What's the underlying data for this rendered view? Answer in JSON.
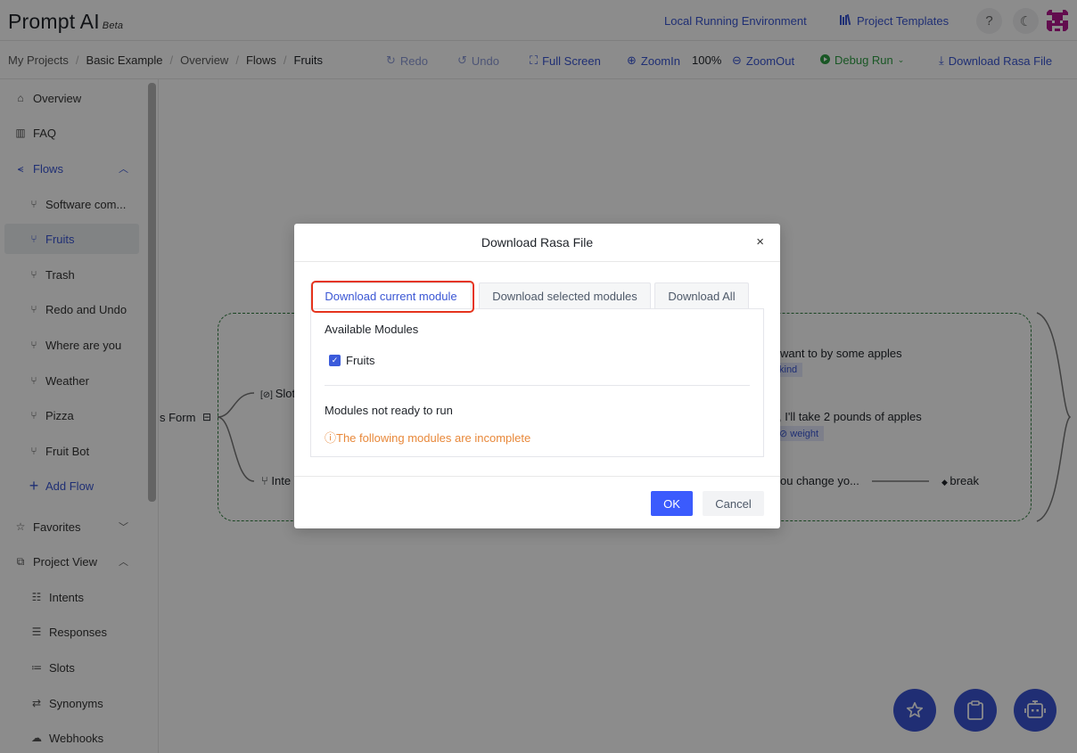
{
  "app": {
    "title": "Prompt AI",
    "badge": "Beta"
  },
  "header": {
    "local_env": "Local Running Environment",
    "templates": "Project Templates",
    "help": "?",
    "theme": "☾"
  },
  "breadcrumb": [
    "My Projects",
    "Basic Example",
    "Overview",
    "Flows",
    "Fruits"
  ],
  "toolbar": {
    "redo": "Redo",
    "undo": "Undo",
    "fullscreen": "Full Screen",
    "zoom_in": "ZoomIn",
    "zoom_level": "100%",
    "zoom_out": "ZoomOut",
    "debug_run": "Debug Run",
    "download": "Download Rasa File"
  },
  "sidebar": {
    "overview": "Overview",
    "faq": "FAQ",
    "flows": "Flows",
    "flow_items": [
      "Software com...",
      "Fruits",
      "Trash",
      "Redo and Undo",
      "Where are you",
      "Weather",
      "Pizza",
      "Fruit Bot"
    ],
    "add_flow": "Add Flow",
    "favorites": "Favorites",
    "project_view": "Project View",
    "project_items": [
      "Intents",
      "Responses",
      "Slots",
      "Synonyms",
      "Webhooks"
    ]
  },
  "canvas": {
    "form_label": "s Form",
    "slot_label": "Slot",
    "intent_label": "Inte",
    "msg1": "want to by some apples",
    "tag1": "kind",
    "msg2": ", I'll take 2 pounds of apples",
    "tag2": "weight",
    "msg3": "ou change yo...",
    "break": "break"
  },
  "modal": {
    "title": "Download Rasa File",
    "close": "×",
    "tabs": [
      "Download current module",
      "Download selected modules",
      "Download All"
    ],
    "active_tab": 0,
    "available_label": "Available Modules",
    "modules": [
      {
        "name": "Fruits",
        "checked": true
      }
    ],
    "not_ready_label": "Modules not ready to run",
    "warning": "ⓘThe following modules are incomplete",
    "ok": "OK",
    "cancel": "Cancel"
  },
  "colors": {
    "accent": "#3a56d4",
    "primary_button": "#3b5bfd",
    "warning": "#e8883a",
    "highlight_border": "#e5341d",
    "debug_green": "#2f9e44"
  }
}
